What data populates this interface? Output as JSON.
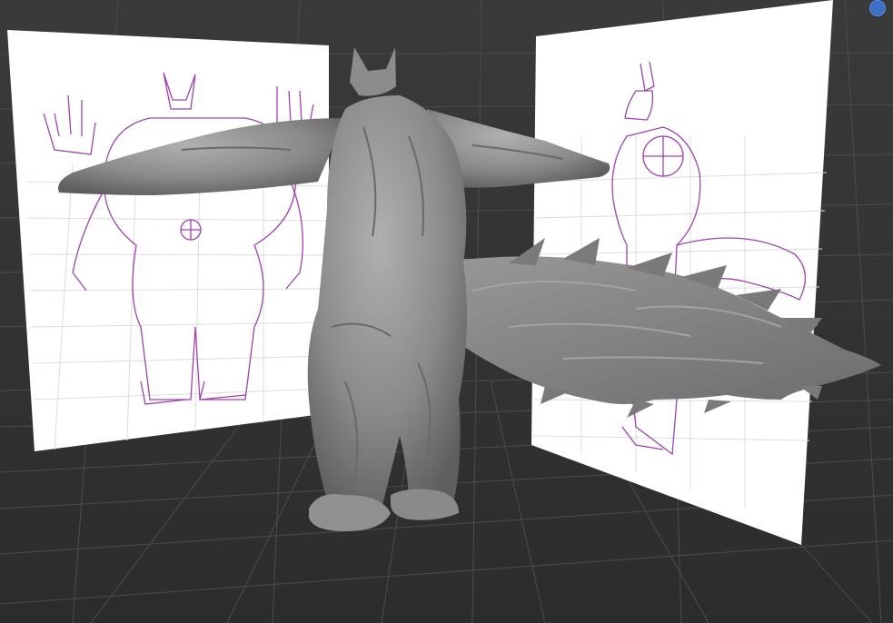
{
  "viewport": {
    "background_color": "#3d3d3d",
    "grid_color": "#555555",
    "reference_line_color": "#a040b0",
    "model_color": "#8f8f8f",
    "icons": {
      "navigation_gizmo": "blue-dot-icon"
    }
  }
}
